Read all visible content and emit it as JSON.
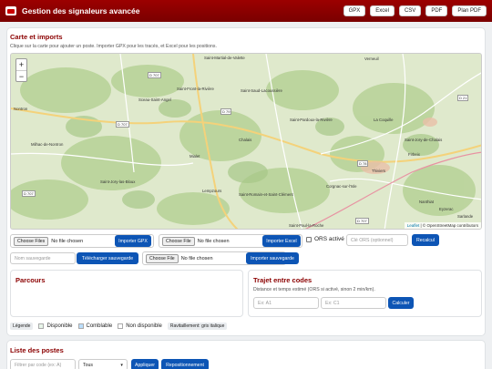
{
  "app": {
    "title": "Gestion des signaleurs avancée",
    "buttons": [
      "GPX",
      "Excel",
      "CSV",
      "PDF",
      "Plan PDF"
    ]
  },
  "map_section": {
    "title": "Carte et imports",
    "hint": "Clique sur la carte pour ajouter un poste. Importer GPX pour les tracés, et Excel pour les positions.",
    "zoom_in": "+",
    "zoom_out": "−",
    "attribution_leaflet": "Leaflet",
    "attribution_rest": "| © OpenStreetMap contributors",
    "places": [
      "Verneuil",
      "Saint-Martial-de-Valette",
      "Nontron",
      "Saint-Front-la-Rivière",
      "Sceau-Saint-Angel",
      "Saint-Saud-Lacoussière",
      "Saint-Pardoux-la-Rivière",
      "Milhac-de-Nontron",
      "Saint-Jory-de-Chalais",
      "Chalais",
      "La Coquille",
      "Firbeix",
      "Mialet",
      "Saint-Jory-las-Bloux",
      "Thiviers",
      "Lempzours",
      "Corgnac-sur-l'Isle",
      "Saint-Romain-et-Saint-Clément",
      "Nanthiat",
      "Eyzerac",
      "Saint-Paul-la-Roche",
      "Sarlande"
    ],
    "roads": [
      "D 707",
      "D 707",
      "D 79",
      "D 21",
      "D 707",
      "D 78",
      "D 707"
    ]
  },
  "imports": {
    "choose_files_label": "Choose Files",
    "choose_file_label": "Choose File",
    "no_file": "No file chosen",
    "import_gpx": "Importer GPX",
    "import_excel": "Importer Excel",
    "ors_label": "ORS activé",
    "ors_key_placeholder": "Clé ORS (optionnel)",
    "recalc": "Recalcul",
    "save_name_placeholder": "Nom sauvegarde",
    "download_save": "Télécharger sauvegarde",
    "import_save": "Importer sauvegarde"
  },
  "parcours": {
    "title": "Parcours"
  },
  "trajet": {
    "title": "Trajet entre codes",
    "hint": "Distance et temps estimé (ORS si activé, sinon 2 min/km).",
    "from_placeholder": "Ex: A1",
    "to_placeholder": "Ex: C1",
    "compute": "Calculer"
  },
  "legend": {
    "label": "Légende",
    "available": "Disponible",
    "fillable": "Comblable",
    "unavailable": "Non disponible",
    "supply": "Ravitaillement: gris italique",
    "colors": {
      "available": "#e8f5e9",
      "fillable": "#bbdefb",
      "unavailable": "#ffffff"
    }
  },
  "list": {
    "title": "Liste des postes",
    "filter_placeholder": "Filtrer par code (ex: A)",
    "select_value": "Tous",
    "apply": "Appliquer",
    "reposition": "Repositionnement"
  },
  "theme": {
    "brand": "#8b0000",
    "primary_button": "#0d55b5"
  }
}
